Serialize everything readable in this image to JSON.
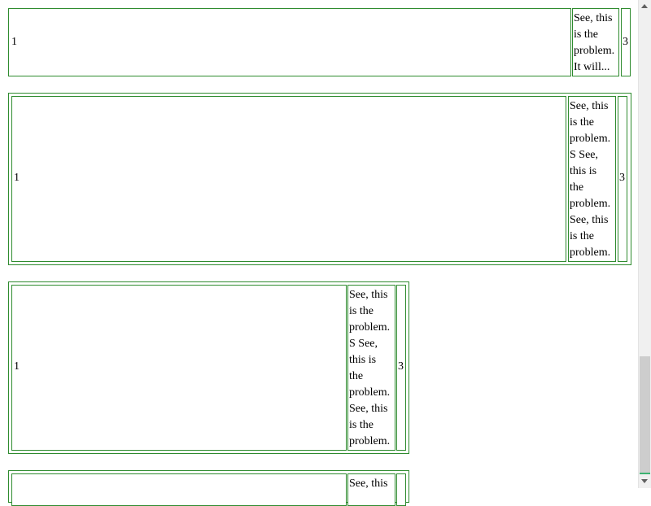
{
  "rows": [
    {
      "left": "1",
      "middle": "See, this\nis the\nproblem.\nIt will...",
      "right": "3"
    },
    {
      "left": "1",
      "middle": "See, this\nis the\nproblem.\nS See,\nthis is\nthe\nproblem.\nSee, this\nis the\nproblem.",
      "right": "3"
    },
    {
      "left": "1",
      "middle": "See, this\nis the\nproblem.\nS See,\nthis is\nthe\nproblem.\nSee, this\nis the\nproblem.",
      "right": "3"
    },
    {
      "middle": "See, this"
    }
  ],
  "colors": {
    "border": "#2e8b2e",
    "background": "#ffffff"
  },
  "scrollbar": {
    "icons": [
      "arrow-up-icon",
      "arrow-down-icon"
    ]
  }
}
